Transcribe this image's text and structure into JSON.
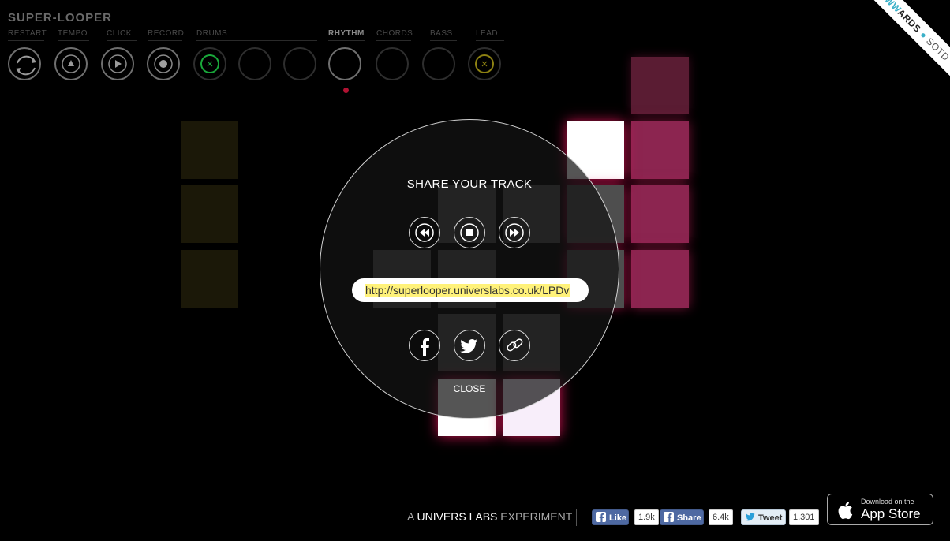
{
  "app": {
    "logo": "SUPER-LOOPER"
  },
  "controls": {
    "restart": "RESTART",
    "tempo": "TEMPO",
    "click": "CLICK",
    "record": "RECORD",
    "drums": "DRUMS",
    "rhythm": "RHYTHM",
    "chords": "CHORDS",
    "bass": "BASS",
    "lead": "LEAD"
  },
  "colors": {
    "drums": "#19a83a",
    "lead": "#b8a81a",
    "accent": "#e8145a",
    "highlight": "#fff27a"
  },
  "share_modal": {
    "title": "SHARE YOUR TRACK",
    "url": "http://superlooper.universlabs.co.uk/LPDv",
    "close": "CLOSE"
  },
  "badge": {
    "aw": "AW",
    "www": "WW",
    "ards": "ARDS",
    "sotd": "SOTD"
  },
  "footer": {
    "prefix": "A",
    "brand": "UNIVERS LABS",
    "suffix": "EXPERIMENT",
    "like_label": "Like",
    "like_count": "1.9k",
    "share_label": "Share",
    "share_count": "6.4k",
    "tweet_label": "Tweet",
    "tweet_count": "1,301",
    "appstore_small": "Download on the",
    "appstore_big": "App Store"
  }
}
